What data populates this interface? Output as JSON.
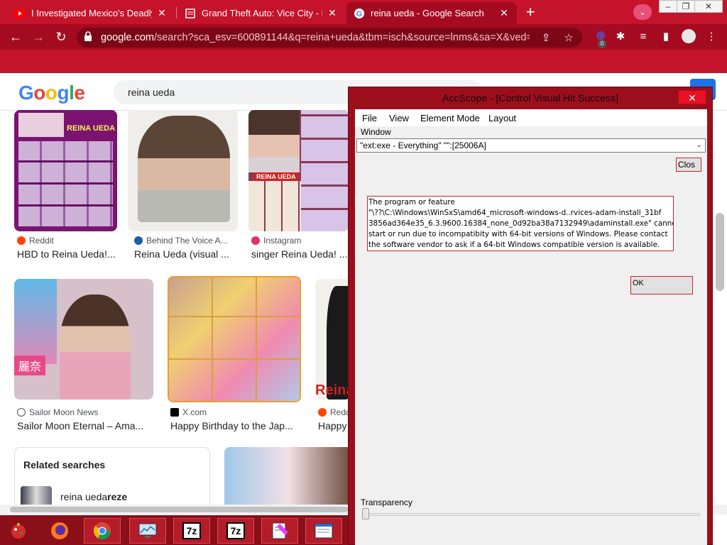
{
  "tabs": [
    {
      "title": "I Investigated Mexico's Deadly C",
      "icon": "youtube-icon"
    },
    {
      "title": "Grand Theft Auto: Vice City - Do",
      "icon": "page-icon"
    },
    {
      "title": "reina ueda - Google Search",
      "icon": "google-icon",
      "active": true
    }
  ],
  "omnibox": {
    "domain": "google.com",
    "path": "/search?sca_esv=600891144&q=reina+ueda&tbm=isch&source=lnms&sa=X&ved=...",
    "extension_badge": "0"
  },
  "google": {
    "logo_letters": [
      "G",
      "o",
      "o",
      "g",
      "l",
      "e"
    ],
    "query": "reina ueda"
  },
  "results": [
    {
      "source": "Reddit",
      "caption": "HBD to Reina Ueda!...",
      "thumb_text": "REINA UEDA"
    },
    {
      "source": "Behind The Voice A...",
      "caption": "Reina Ueda (visual ..."
    },
    {
      "source": "Instagram",
      "caption": "singer Reina Ueda! ...",
      "thumb_text": "REINA UEDA"
    },
    {
      "source": "Sailor Moon News",
      "caption": "Sailor Moon Eternal – Ama...",
      "thumb_text": "麗奈"
    },
    {
      "source": "X.com",
      "caption": "Happy Birthday to the Jap..."
    },
    {
      "source": "Redd",
      "caption": "Happy",
      "thumb_text": "Reina"
    }
  ],
  "related": {
    "heading": "Related searches",
    "item_prefix": "reina ueda ",
    "item_bold": "reze"
  },
  "accscope": {
    "title": "AccScope - [Control Visual Hit Success]",
    "close_glyph": "✕",
    "menu": [
      "File",
      "View",
      "Element Mode",
      "Layout"
    ],
    "window_label": "Window",
    "window_value": "\"ext:exe - Everything\" \"\":[25006A]",
    "close_button": "Clos",
    "message_lines": [
      "The program or feature",
      "\"\\??\\C:\\Windows\\WinSxS\\amd64_microsoft-windows-d..rvices-adam-install_31bf",
      "3856ad364e35_6.3.9600.16384_none_0d92ba38a7132949\\adaminstall.exe\" cannot",
      "start or run due to incompatibity with 64-bit versions of Windows. Please contact",
      "the software vendor to ask if a 64-bit Windows compatible version is available."
    ],
    "ok_button": "OK",
    "transparency_label": "Transparency"
  },
  "taskbar": [
    {
      "name": "christmas-ornament-icon"
    },
    {
      "name": "firefox-icon"
    },
    {
      "name": "chrome-icon"
    },
    {
      "name": "monitor-app-icon"
    },
    {
      "name": "7zip-icon",
      "label": "7z"
    },
    {
      "name": "7zip-icon-2",
      "label": "7z"
    },
    {
      "name": "notepad-app-icon"
    },
    {
      "name": "window-app-icon"
    }
  ],
  "colors": {
    "theme_red": "#c4132a",
    "toolbar_red": "#a50b20",
    "accscope_frame": "#9b0f1c"
  }
}
